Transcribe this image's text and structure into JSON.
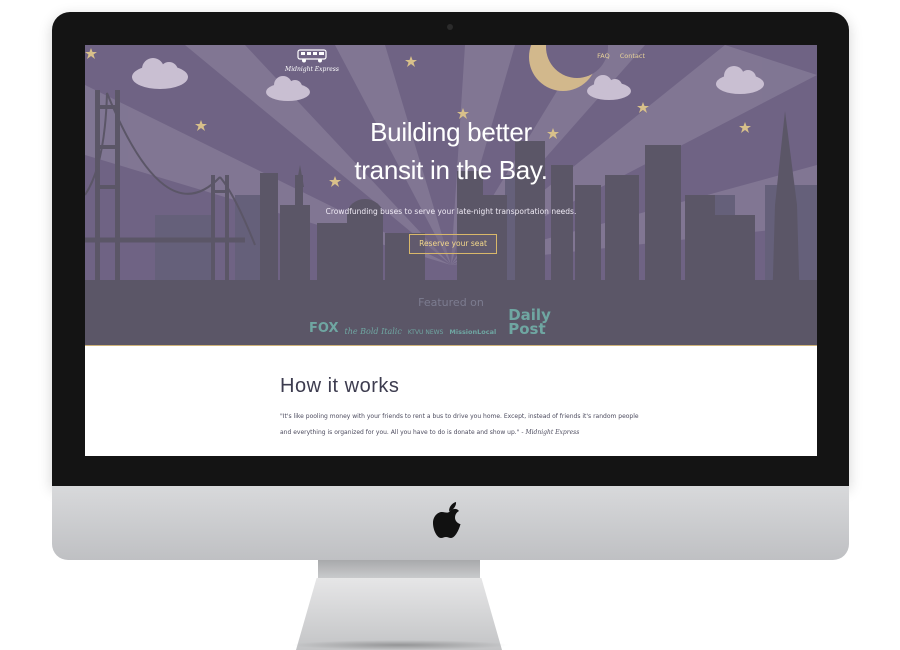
{
  "nav": {
    "faq": "FAQ",
    "contact": "Contact"
  },
  "brand": {
    "name": "Midnight Express"
  },
  "hero": {
    "headline_line1": "Building better",
    "headline_line2": "transit in the Bay.",
    "tagline": "Crowdfunding buses to serve your late-night transportation needs.",
    "cta_label": "Reserve your seat"
  },
  "featured": {
    "heading": "Featured on",
    "logos": [
      "FOX",
      "the Bold Italic",
      "KTVU NEWS",
      "MissionLocal",
      "",
      "Daily Post"
    ]
  },
  "how": {
    "title": "How it works",
    "quote_text": "\"It's like pooling money with your friends to rent a bus to drive you home. Except, instead of friends it's random people and everything is organized for you. All you have to do is donate and show up.\" -",
    "quote_author": "Midnight Express"
  },
  "colors": {
    "hero_bg": "#6f6384",
    "skyline": "#5b5667",
    "gold": "#d9b86a",
    "accent_text": "#3d3c4f"
  },
  "icons": [
    "bus-icon",
    "apple-logo-icon",
    "star-icon",
    "cloud-icon",
    "moon-icon"
  ]
}
